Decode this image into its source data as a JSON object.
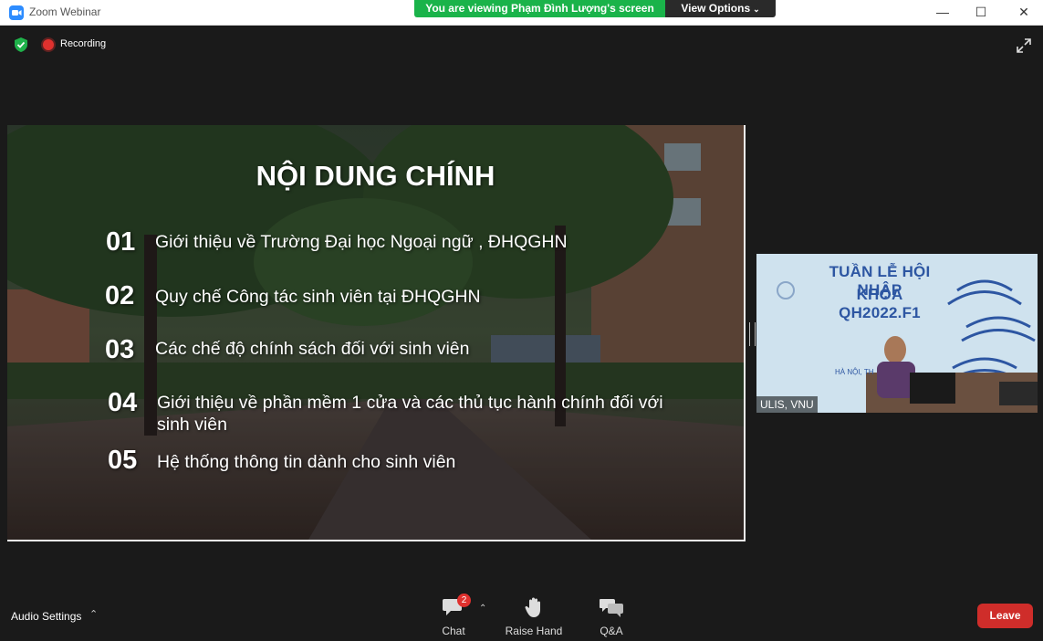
{
  "titlebar": {
    "app_title": "Zoom Webinar",
    "share_banner": "You are viewing Phạm Đình Lượng's screen",
    "view_options": "View Options",
    "minimize_icon": "—",
    "maximize_icon": "☐",
    "close_icon": "✕"
  },
  "meeting": {
    "recording_label": "Recording"
  },
  "slide": {
    "title": "NỘI DUNG CHÍNH",
    "items": [
      {
        "num": "01",
        "text": "Giới thiệu về Trường Đại học Ngoại ngữ , ĐHQGHN"
      },
      {
        "num": "02",
        "text": "Quy chế Công tác sinh viên tại ĐHQGHN"
      },
      {
        "num": "03",
        "text": "Các chế độ chính sách đối với sinh viên"
      },
      {
        "num": "04",
        "text": "Giới thiệu về phần mềm 1 cửa và các thủ tục hành chính đối với sinh viên"
      },
      {
        "num": "05",
        "text": "Hệ thống thông tin dành cho sinh viên"
      }
    ]
  },
  "video": {
    "banner_line1": "TUẦN LỄ HỘI NHẬP",
    "banner_line2": "KHÓA QH2022.F1",
    "place_text": "HÀ NỘI, TH",
    "participant_name": "ULIS, VNU"
  },
  "bottom_bar": {
    "audio_settings": "Audio Settings",
    "chat_label": "Chat",
    "chat_badge": "2",
    "raise_hand_label": "Raise Hand",
    "qa_label": "Q&A",
    "leave_label": "Leave"
  },
  "colors": {
    "share_banner": "#1ab34a",
    "leave": "#cf2d2a",
    "background": "#1a1a1a",
    "video_banner_text": "#2d56a2"
  }
}
